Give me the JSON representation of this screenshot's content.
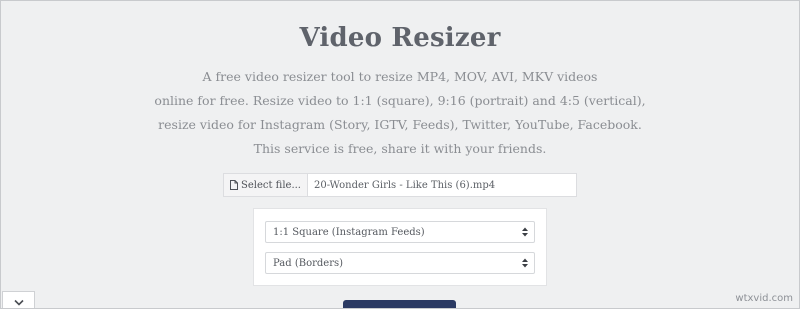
{
  "header": {
    "title": "Video Resizer"
  },
  "description": {
    "lines": [
      "A free video resizer tool to resize MP4, MOV, AVI, MKV videos",
      "online for free. Resize video to 1:1 (square), 9:16 (portrait) and 4:5 (vertical),",
      "resize video for Instagram (Story, IGTV, Feeds), Twitter, YouTube, Facebook.",
      "This service is free, share it with your friends."
    ]
  },
  "file_picker": {
    "button_label": "Select file...",
    "button_icon": "document-icon",
    "file_name": "20-Wonder Girls - Like This (6).mp4"
  },
  "options": {
    "aspect_select": {
      "value": "1:1 Square (Instagram Feeds)",
      "icon": "select-arrows-icon"
    },
    "mode_select": {
      "value": "Pad (Borders)",
      "icon": "select-arrows-icon"
    }
  },
  "bottom_controls": {
    "collapse_icon": "chevron-down-icon"
  },
  "watermark": {
    "text": "wtxvid.com"
  },
  "colors": {
    "background": "#eff0f1",
    "title": "#5f636b",
    "description": "#8a8d92",
    "submit_button": "#2b3a63"
  }
}
